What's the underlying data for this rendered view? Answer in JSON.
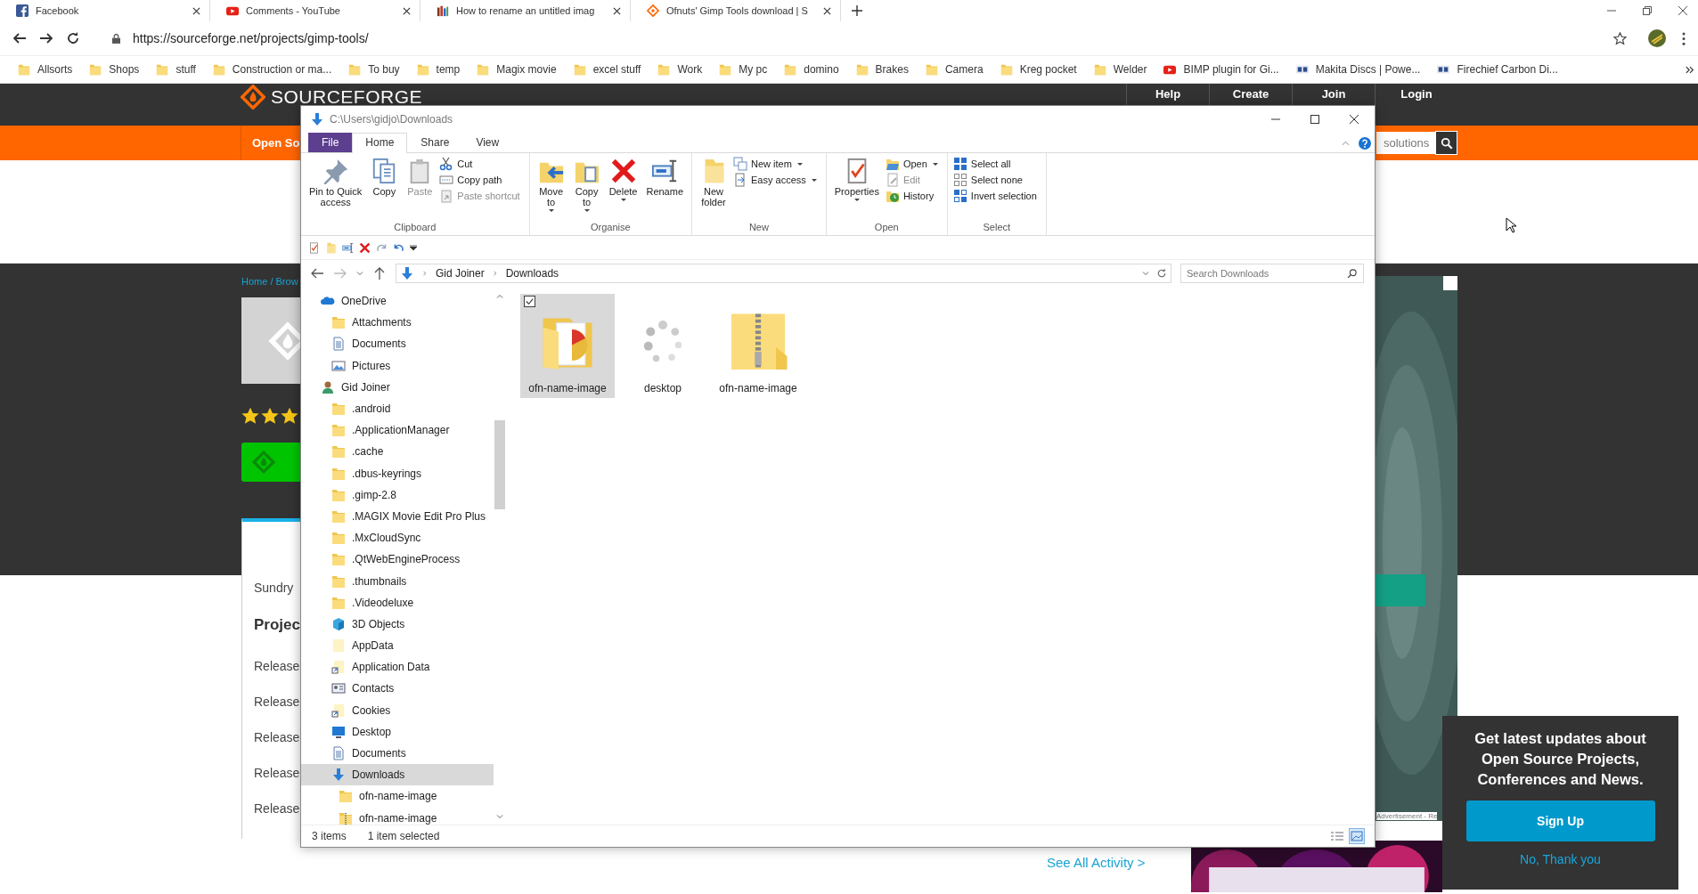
{
  "browser": {
    "tabs": [
      {
        "title": "Facebook",
        "kind": "social"
      },
      {
        "title": "Comments - YouTube",
        "kind": "video"
      },
      {
        "title": "How to rename an untitled imag",
        "kind": "chart"
      },
      {
        "title": "Ofnuts' Gimp Tools download | S",
        "kind": "diamond"
      }
    ],
    "url": "https://sourceforge.net/projects/gimp-tools/",
    "bookmarks": [
      {
        "label": "Allsorts",
        "kind": "folder"
      },
      {
        "label": "Shops",
        "kind": "folder"
      },
      {
        "label": "stuff",
        "kind": "folder"
      },
      {
        "label": "Construction or ma...",
        "kind": "folder"
      },
      {
        "label": "To buy",
        "kind": "folder"
      },
      {
        "label": "temp",
        "kind": "folder"
      },
      {
        "label": "Magix movie",
        "kind": "folder"
      },
      {
        "label": "excel stuff",
        "kind": "folder"
      },
      {
        "label": "Work",
        "kind": "folder"
      },
      {
        "label": "My pc",
        "kind": "folder"
      },
      {
        "label": "domino",
        "kind": "folder"
      },
      {
        "label": "Brakes",
        "kind": "folder"
      },
      {
        "label": "Camera",
        "kind": "folder"
      },
      {
        "label": "Kreg pocket",
        "kind": "folder"
      },
      {
        "label": "Welder",
        "kind": "folder"
      },
      {
        "label": "BIMP plugin for Gi...",
        "kind": "video"
      },
      {
        "label": "Makita Discs | Powe...",
        "kind": "site"
      },
      {
        "label": "Firechief Carbon Di...",
        "kind": "site"
      }
    ]
  },
  "site": {
    "logo": "SOURCEFORGE",
    "nav": [
      "Help",
      "Create",
      "Join",
      "Login"
    ],
    "menu_item": "Open So",
    "search": {
      "placeholder": "solutions"
    },
    "breadcrumb": "Home / Brow",
    "stars": 3,
    "tagline": "Sundry",
    "heading": "Projec",
    "releases": [
      "Release",
      "Release",
      "Release",
      "Release",
      "Release"
    ],
    "activity_link": "See All Activity >",
    "ad_label": "Advertisement - Re"
  },
  "popup": {
    "text": "Get latest updates about Open Source Projects, Conferences and News.",
    "button": "Sign Up",
    "dismiss": "No, Thank you"
  },
  "explorer": {
    "title": "C:\\Users\\gidjo\\Downloads",
    "ribbon_tabs": [
      {
        "label": "File",
        "kind": "file",
        "selected": false
      },
      {
        "label": "Home",
        "kind": "tab",
        "selected": true
      },
      {
        "label": "Share",
        "kind": "tab",
        "selected": false
      },
      {
        "label": "View",
        "kind": "tab",
        "selected": false
      }
    ],
    "groups": [
      {
        "label": "Clipboard",
        "buttons": [
          {
            "label": "Pin to Quick\naccess",
            "kind": "large",
            "disabled": false,
            "menu": false
          },
          {
            "label": "Copy",
            "kind": "large",
            "disabled": false,
            "menu": false
          },
          {
            "label": "Paste",
            "kind": "large",
            "disabled": true,
            "menu": false
          },
          {
            "label": "Cut",
            "kind": "small",
            "disabled": false,
            "menu": false
          },
          {
            "label": "Copy path",
            "kind": "small",
            "disabled": false,
            "menu": false
          },
          {
            "label": "Paste shortcut",
            "kind": "small",
            "disabled": true,
            "menu": false
          }
        ]
      },
      {
        "label": "Organise",
        "buttons": [
          {
            "label": "Move\nto",
            "kind": "large",
            "disabled": false,
            "menu": true
          },
          {
            "label": "Copy\nto",
            "kind": "large",
            "disabled": false,
            "menu": true
          },
          {
            "label": "Delete",
            "kind": "large",
            "disabled": false,
            "menu": true
          },
          {
            "label": "Rename",
            "kind": "large",
            "disabled": false,
            "menu": false
          }
        ]
      },
      {
        "label": "New",
        "buttons": [
          {
            "label": "New\nfolder",
            "kind": "large",
            "disabled": false,
            "menu": false
          },
          {
            "label": "New item",
            "kind": "small",
            "disabled": false,
            "menu": true
          },
          {
            "label": "Easy access",
            "kind": "small",
            "disabled": false,
            "menu": true
          }
        ]
      },
      {
        "label": "Open",
        "buttons": [
          {
            "label": "Properties",
            "kind": "large",
            "disabled": false,
            "menu": true
          },
          {
            "label": "Open",
            "kind": "small",
            "disabled": false,
            "menu": true
          },
          {
            "label": "Edit",
            "kind": "small",
            "disabled": true,
            "menu": false
          },
          {
            "label": "History",
            "kind": "small",
            "disabled": false,
            "menu": false
          }
        ]
      },
      {
        "label": "Select",
        "buttons": [
          {
            "label": "Select all",
            "kind": "small",
            "disabled": false,
            "menu": false
          },
          {
            "label": "Select none",
            "kind": "small",
            "disabled": false,
            "menu": false
          },
          {
            "label": "Invert selection",
            "kind": "small",
            "disabled": false,
            "menu": false
          }
        ]
      }
    ],
    "path": [
      "Gid Joiner",
      "Downloads"
    ],
    "search": {
      "placeholder": "Search Downloads"
    },
    "nav": [
      {
        "label": "OneDrive",
        "kind": "cloud",
        "selected": false,
        "children": [
          {
            "label": "Attachments",
            "kind": "folder",
            "selected": false
          },
          {
            "label": "Documents",
            "kind": "document",
            "selected": false
          },
          {
            "label": "Pictures",
            "kind": "pictures",
            "selected": false
          }
        ]
      },
      {
        "label": "Gid Joiner",
        "kind": "user",
        "selected": false,
        "children": [
          {
            "label": ".android",
            "kind": "folder",
            "selected": false
          },
          {
            "label": ".ApplicationManager",
            "kind": "folder",
            "selected": false
          },
          {
            "label": ".cache",
            "kind": "folder",
            "selected": false
          },
          {
            "label": ".dbus-keyrings",
            "kind": "folder",
            "selected": false
          },
          {
            "label": ".gimp-2.8",
            "kind": "folder",
            "selected": false
          },
          {
            "label": ".MAGIX Movie Edit Pro Plus",
            "kind": "folder",
            "selected": false
          },
          {
            "label": ".MxCloudSync",
            "kind": "folder",
            "selected": false
          },
          {
            "label": ".QtWebEngineProcess",
            "kind": "folder",
            "selected": false
          },
          {
            "label": ".thumbnails",
            "kind": "folder",
            "selected": false
          },
          {
            "label": ".Videodeluxe",
            "kind": "folder",
            "selected": false
          },
          {
            "label": "3D Objects",
            "kind": "cube",
            "selected": false
          },
          {
            "label": "AppData",
            "kind": "blank",
            "selected": false
          },
          {
            "label": "Application Data",
            "kind": "shortcut",
            "selected": false
          },
          {
            "label": "Contacts",
            "kind": "contacts",
            "selected": false
          },
          {
            "label": "Cookies",
            "kind": "shortcut",
            "selected": false
          },
          {
            "label": "Desktop",
            "kind": "desktop",
            "selected": false
          },
          {
            "label": "Documents",
            "kind": "document",
            "selected": false
          },
          {
            "label": "Downloads",
            "kind": "download",
            "selected": true,
            "children": [
              {
                "label": "ofn-name-image",
                "kind": "folder",
                "selected": false
              },
              {
                "label": "ofn-name-image",
                "kind": "zip",
                "selected": false
              }
            ]
          }
        ]
      }
    ],
    "files": [
      {
        "label": "ofn-name-image",
        "kind": "folder",
        "selected": true
      },
      {
        "label": "desktop",
        "kind": "loading",
        "selected": false
      },
      {
        "label": "ofn-name-image",
        "kind": "zip",
        "selected": false
      }
    ],
    "status": {
      "count": "3 items",
      "selection": "1 item selected"
    }
  }
}
